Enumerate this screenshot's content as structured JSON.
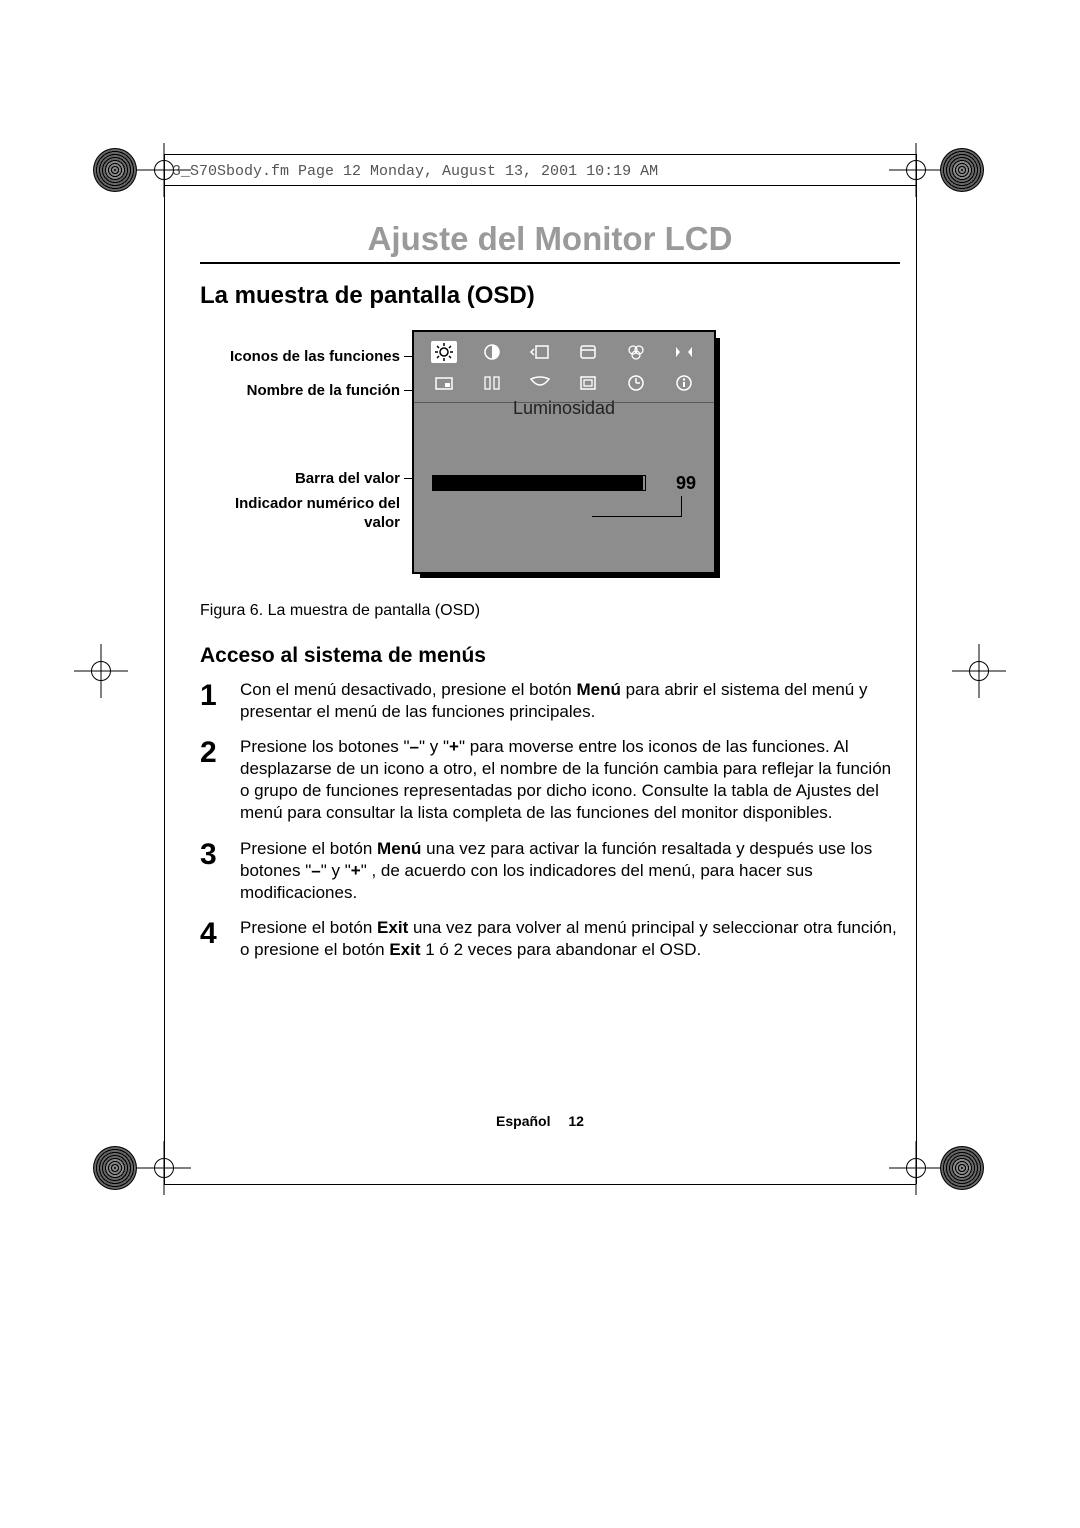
{
  "file_header": "3_S70Sbody.fm  Page 12  Monday, August 13, 2001  10:19 AM",
  "page_title": "Ajuste del Monitor LCD",
  "section_title": "La muestra de pantalla (OSD)",
  "labels": {
    "icons": "Iconos de las funciones",
    "name": "Nombre de la función",
    "bar": "Barra del valor",
    "numeric": "Indicador numérico del valor"
  },
  "osd": {
    "function_name": "Luminosidad",
    "value": "99",
    "icons": [
      "brightness-icon",
      "contrast-icon",
      "hpos-icon",
      "autolevel-icon",
      "color-icon",
      "hsize-icon",
      "osdpos-icon",
      "language-icon",
      "shape-icon",
      "window-icon",
      "clock-icon",
      "info-icon"
    ]
  },
  "caption": "Figura 6.  La muestra de pantalla (OSD)",
  "subsection_title": "Acceso al sistema de menús",
  "steps": [
    {
      "n": "1",
      "parts": [
        "Con el menú desactivado, presione el botón ",
        "Menú",
        " para abrir el sistema del menú y presentar el menú de las funciones principales."
      ]
    },
    {
      "n": "2",
      "parts": [
        "Presione los botones \"",
        "–",
        "\" y \"",
        "+",
        "\"  para moverse entre los iconos de las funciones. Al desplazarse de un icono a otro, el nombre de la función cambia para reflejar la función o grupo de funciones representadas por dicho icono. Consulte la tabla de Ajustes del menú para consultar la lista completa de las funciones del monitor disponibles."
      ]
    },
    {
      "n": "3",
      "parts": [
        "Presione el botón ",
        "Menú",
        " una vez para activar la función resaltada y después use los botones \"",
        "–",
        "\" y \"",
        "+",
        "\" , de acuerdo con los indicadores del menú, para hacer sus modificaciones."
      ]
    },
    {
      "n": "4",
      "parts": [
        "Presione el botón ",
        "Exit",
        " una vez para volver al menú principal y seleccionar otra función, o presione el botón ",
        "Exit",
        " 1 ó 2 veces para abandonar el OSD."
      ]
    }
  ],
  "footer": {
    "lang": "Español",
    "page": "12"
  }
}
